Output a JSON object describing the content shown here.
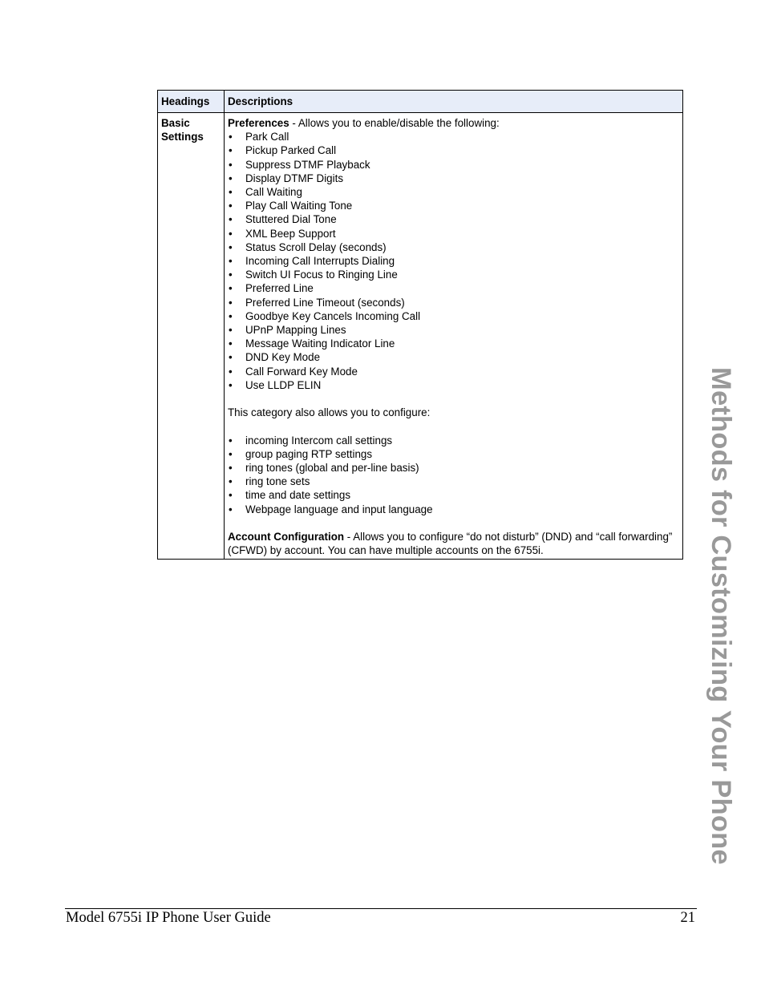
{
  "table": {
    "headers": [
      "Headings",
      "Descriptions"
    ],
    "row": {
      "heading_line1": "Basic",
      "heading_line2": "Settings",
      "preferences": {
        "label": "Preferences",
        "text": " - Allows you to enable/disable the following:",
        "items": [
          "Park Call",
          "Pickup Parked Call",
          "Suppress DTMF Playback",
          "Display DTMF Digits",
          "Call Waiting",
          "Play Call Waiting Tone",
          "Stuttered Dial Tone",
          "XML Beep Support",
          "Status Scroll Delay (seconds)",
          "Incoming Call Interrupts Dialing",
          "Switch UI Focus to Ringing Line",
          "Preferred Line",
          "Preferred Line Timeout (seconds)",
          "Goodbye Key Cancels Incoming Call",
          "UPnP Mapping Lines",
          "Message Waiting Indicator Line",
          "DND Key Mode",
          "Call Forward Key Mode",
          "Use LLDP ELIN"
        ]
      },
      "configure_intro": "This category also allows you to configure:",
      "configure_items": [
        "incoming Intercom call settings",
        "group paging RTP settings",
        "ring tones (global and per-line basis)",
        "ring tone sets",
        "time and date settings",
        "Webpage language and input language"
      ],
      "account": {
        "label": "Account Configuration",
        "text": " - Allows you to configure “do not disturb” (DND) and “call forwarding” (CFWD) by account. You can have multiple accounts on the 6755i."
      }
    }
  },
  "side_title": "Methods for Customizing Your Phone",
  "footer": {
    "title": "Model 6755i IP Phone User Guide",
    "page_number": "21"
  }
}
